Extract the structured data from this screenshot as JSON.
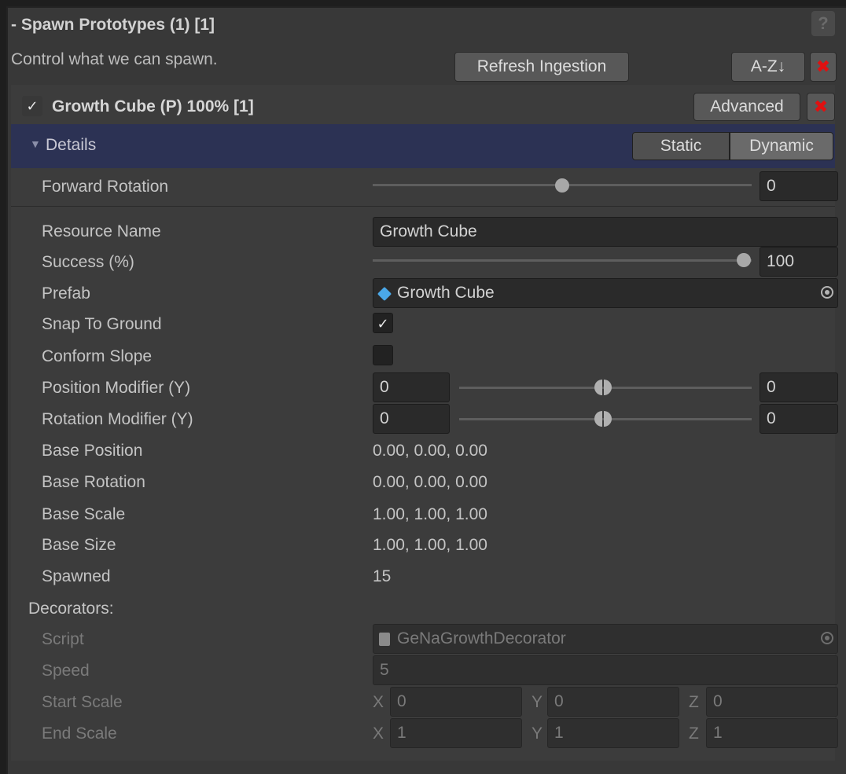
{
  "header": {
    "title": "- Spawn Prototypes (1) [1]",
    "help_label": "?",
    "subtitle": "Control what we can spawn.",
    "refresh_label": "Refresh Ingestion",
    "sort_label": "A-Z↓",
    "remove_glyph": "✖"
  },
  "prototype": {
    "checked_glyph": "✓",
    "title": "Growth Cube (P) 100% [1]",
    "advanced_label": "Advanced",
    "remove_glyph": "✖"
  },
  "details": {
    "title": "Details",
    "arrow": "▼",
    "static_label": "Static",
    "dynamic_label": "Dynamic"
  },
  "fields": {
    "forward_rotation": {
      "label": "Forward Rotation",
      "value": "0",
      "slider_fraction": 0.5
    },
    "resource_name": {
      "label": "Resource Name",
      "value": "Growth Cube"
    },
    "success": {
      "label": "Success (%)",
      "value": "100",
      "slider_fraction": 1.0
    },
    "prefab": {
      "label": "Prefab",
      "value": "Growth Cube",
      "icon": "cube-icon"
    },
    "snap_to_ground": {
      "label": "Snap To Ground",
      "checked": true,
      "glyph": "✓"
    },
    "conform_slope": {
      "label": "Conform Slope",
      "checked": false
    },
    "position_modifier": {
      "label": "Position Modifier (Y)",
      "min": "0",
      "max": "0"
    },
    "rotation_modifier": {
      "label": "Rotation Modifier (Y)",
      "min": "0",
      "max": "0"
    },
    "base_position": {
      "label": "Base Position",
      "value": "0.00, 0.00, 0.00"
    },
    "base_rotation": {
      "label": "Base Rotation",
      "value": "0.00, 0.00, 0.00"
    },
    "base_scale": {
      "label": "Base Scale",
      "value": "1.00, 1.00, 1.00"
    },
    "base_size": {
      "label": "Base Size",
      "value": "1.00, 1.00, 1.00"
    },
    "spawned": {
      "label": "Spawned",
      "value": "15"
    }
  },
  "decorators": {
    "title": "Decorators:",
    "script": {
      "label": "Script",
      "value": "GeNaGrowthDecorator",
      "icon": "script-icon"
    },
    "speed": {
      "label": "Speed",
      "value": "5"
    },
    "start_scale": {
      "label": "Start Scale",
      "x_label": "X",
      "x": "0",
      "y_label": "Y",
      "y": "0",
      "z_label": "Z",
      "z": "0"
    },
    "end_scale": {
      "label": "End Scale",
      "x_label": "X",
      "x": "1",
      "y_label": "Y",
      "y": "1",
      "z_label": "Z",
      "z": "1"
    }
  },
  "colors": {
    "panel": "#383838",
    "details_bar": "#2c3254",
    "remove": "#e01010",
    "cube_icon": "#4aa8e8"
  }
}
